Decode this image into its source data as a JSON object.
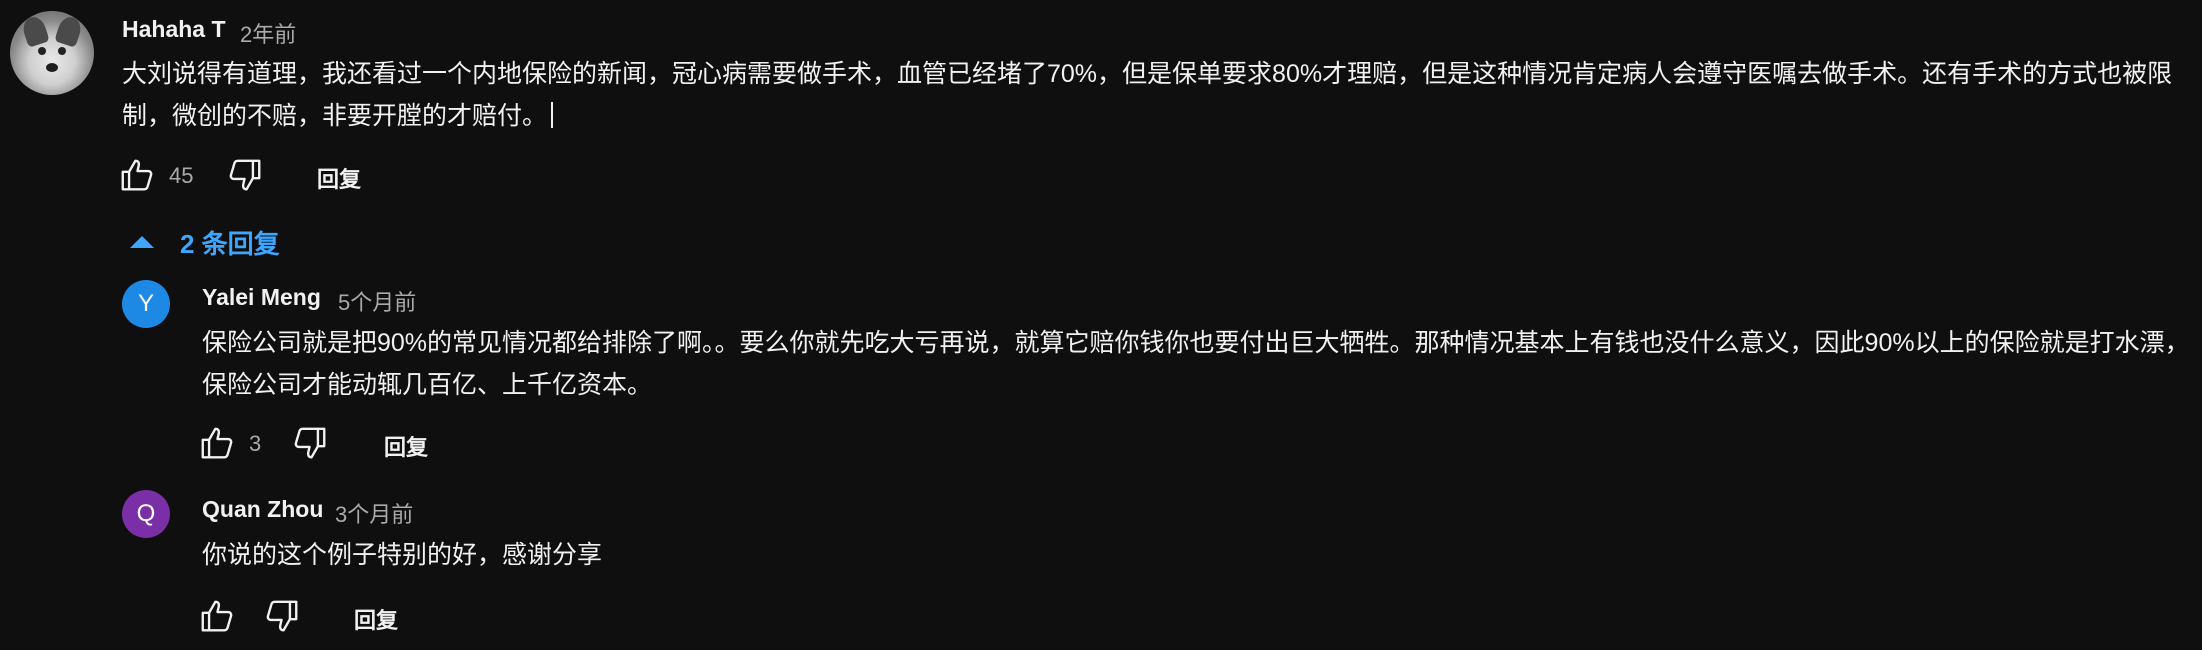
{
  "comment": {
    "author": "Hahaha T",
    "time": "2年前",
    "text": "大刘说得有道理，我还看过一个内地保险的新闻，冠心病需要做手术，血管已经堵了70%，但是保单要求80%才理赔，但是这种情况肯定病人会遵守医嘱去做手术。还有手术的方式也被限制，微创的不赔，非要开膛的才赔付。",
    "likes": "45",
    "reply_label": "回复"
  },
  "replies_toggle": {
    "label": "2 条回复",
    "color": "#3ea6ff"
  },
  "replies": [
    {
      "avatar_letter": "Y",
      "avatar_color": "#1e88e5",
      "author": "Yalei Meng",
      "time": "5个月前",
      "text": "保险公司就是把90%的常见情况都给排除了啊。。要么你就先吃大亏再说，就算它赔你钱你也要付出巨大牺牲。那种情况基本上有钱也没什么意义，因此90%以上的保险就是打水漂，保险公司才能动辄几百亿、上千亿资本。",
      "likes": "3",
      "reply_label": "回复"
    },
    {
      "avatar_letter": "Q",
      "avatar_color": "#7b2fa6",
      "author": "Quan Zhou",
      "time": "3个月前",
      "text": "你说的这个例子特别的好，感谢分享",
      "likes": "",
      "reply_label": "回复"
    }
  ],
  "icons": {
    "like": "thumbs-up-icon",
    "dislike": "thumbs-down-icon",
    "collapse": "triangle-up-icon"
  }
}
